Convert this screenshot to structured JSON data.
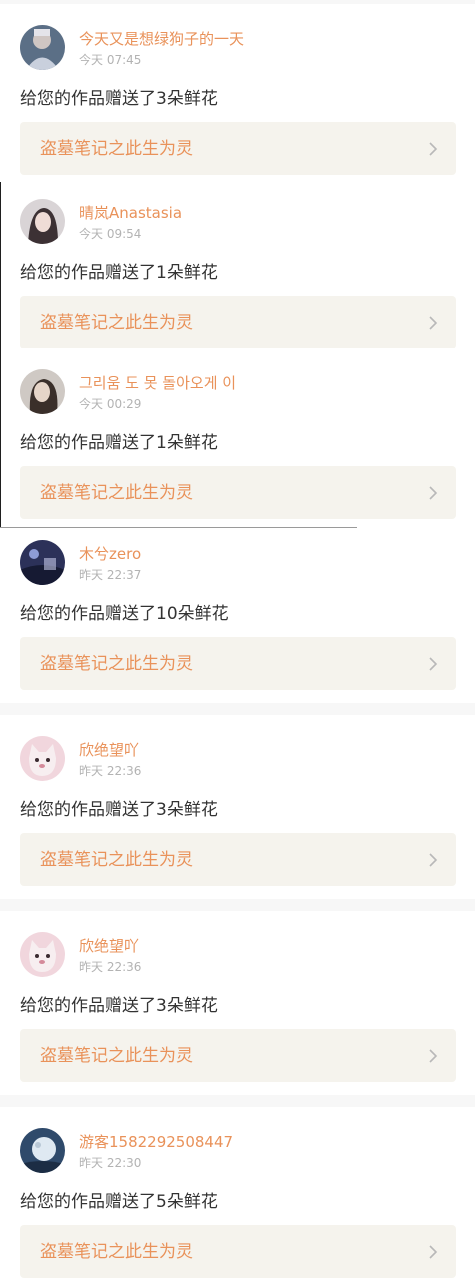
{
  "colors": {
    "accent": "#e9925a",
    "link_background": "#f5f3ed",
    "page_background": "#f7f7f7",
    "card_background": "#ffffff",
    "message_text": "#333333",
    "time_text": "#b3b3b3"
  },
  "notifications": [
    {
      "username": "今天又是想绿狗子的一天",
      "time": "今天 07:45",
      "message": "给您的作品赠送了3朵鲜花",
      "work_title": "盗墓笔记之此生为灵",
      "avatar_icon": "avatar-figure-icon"
    },
    {
      "username": "晴岚Anastasia",
      "time": "今天 09:54",
      "message": "给您的作品赠送了1朵鲜花",
      "work_title": "盗墓笔记之此生为灵",
      "avatar_icon": "avatar-portrait-icon"
    },
    {
      "username": "그리움 도 못 돌아오게 이",
      "time": "今天 00:29",
      "message": "给您的作品赠送了1朵鲜花",
      "work_title": "盗墓笔记之此生为灵",
      "avatar_icon": "avatar-portrait-icon"
    },
    {
      "username": "木兮zero",
      "time": "昨天 22:37",
      "message": "给您的作品赠送了10朵鲜花",
      "work_title": "盗墓笔记之此生为灵",
      "avatar_icon": "avatar-night-icon"
    },
    {
      "username": "欣绝望吖",
      "time": "昨天 22:36",
      "message": "给您的作品赠送了3朵鲜花",
      "work_title": "盗墓笔记之此生为灵",
      "avatar_icon": "avatar-cat-icon"
    },
    {
      "username": "欣绝望吖",
      "time": "昨天 22:36",
      "message": "给您的作品赠送了3朵鲜花",
      "work_title": "盗墓笔记之此生为灵",
      "avatar_icon": "avatar-cat-icon"
    },
    {
      "username": "游客1582292508447",
      "time": "昨天 22:30",
      "message": "给您的作品赠送了5朵鲜花",
      "work_title": "盗墓笔记之此生为灵",
      "avatar_icon": "avatar-moon-icon"
    }
  ]
}
